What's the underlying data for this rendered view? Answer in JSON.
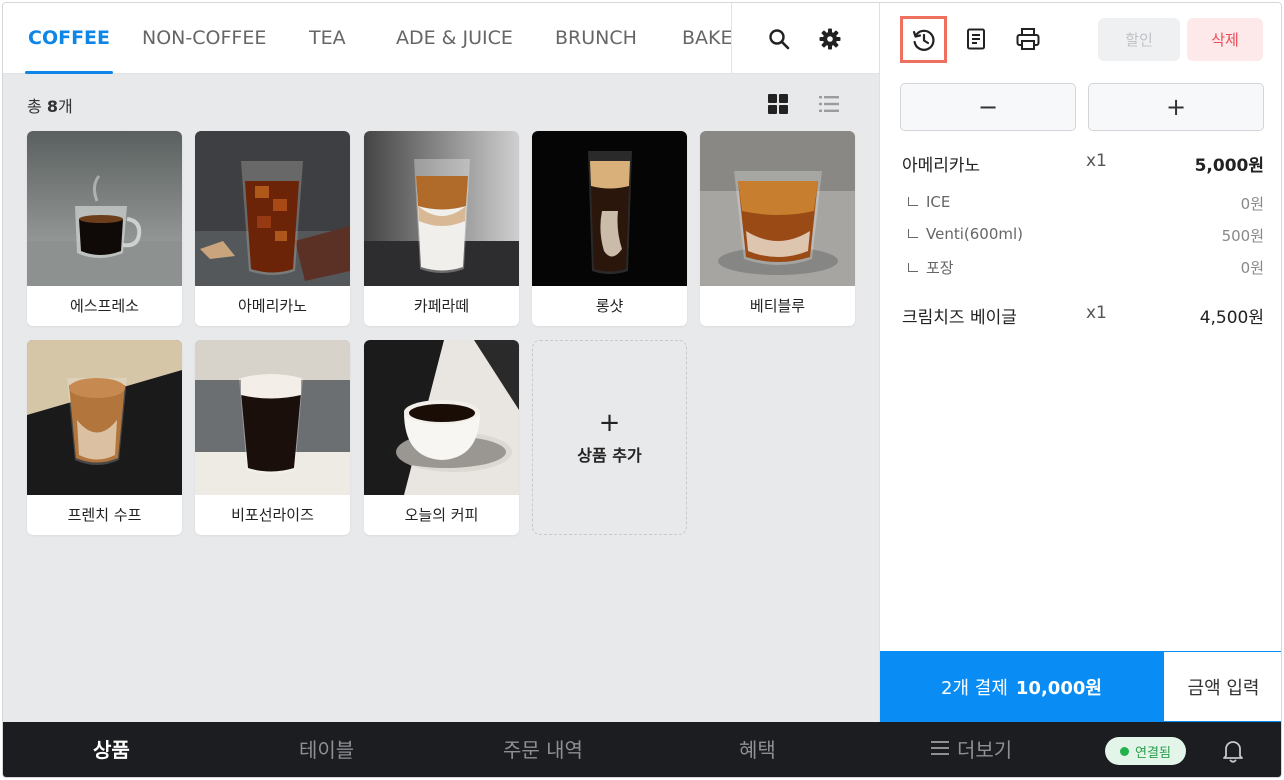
{
  "categories": [
    {
      "label": "COFFEE",
      "active": true
    },
    {
      "label": "NON-COFFEE"
    },
    {
      "label": "TEA"
    },
    {
      "label": "ADE & JUICE"
    },
    {
      "label": "BRUNCH"
    },
    {
      "label": "BAKE"
    }
  ],
  "icons": {
    "search": "search-icon",
    "settings": "gear-icon",
    "grid_view": "grid-view-icon",
    "list_view": "list-view-icon",
    "history": "history-icon",
    "receipt": "receipt-icon",
    "print": "printer-icon",
    "bell": "bell-icon"
  },
  "product_count": {
    "prefix": "총 ",
    "number": "8",
    "suffix": "개"
  },
  "products": [
    {
      "name": "에스프레소"
    },
    {
      "name": "아메리카노"
    },
    {
      "name": "카페라떼"
    },
    {
      "name": "롱샷"
    },
    {
      "name": "베티블루"
    },
    {
      "name": "프렌치 수프"
    },
    {
      "name": "비포선라이즈"
    },
    {
      "name": "오늘의 커피"
    }
  ],
  "add_product": {
    "plus": "+",
    "label": "상품 추가"
  },
  "order_actions": {
    "discount": "할인",
    "delete": "삭제",
    "minus": "−",
    "plus": "+"
  },
  "order_items": [
    {
      "name": "아메리카노",
      "qty": "x1",
      "price": "5,000원",
      "options": [
        {
          "name": "ICE",
          "price": "0원"
        },
        {
          "name": "Venti(600ml)",
          "price": "500원"
        },
        {
          "name": "포장",
          "price": "0원"
        }
      ]
    },
    {
      "name": "크림치즈 베이글",
      "qty": "x1",
      "price": "4,500원",
      "options": []
    }
  ],
  "payment": {
    "prefix": "2개 결제",
    "amount": "10,000원",
    "enter_amount": "금액 입력"
  },
  "bottom_nav": [
    {
      "label": "상품",
      "active": true
    },
    {
      "label": "테이블"
    },
    {
      "label": "주문 내역"
    },
    {
      "label": "혜택"
    },
    {
      "label": "더보기"
    }
  ],
  "connection": {
    "label": "연결됨",
    "color": "#22b14c"
  },
  "colors": {
    "accent": "#0d86e8",
    "pay": "#0a8cf5",
    "delete": "#ee4a57",
    "highlight": "#f07060",
    "nav_bg": "#1c1d21"
  }
}
